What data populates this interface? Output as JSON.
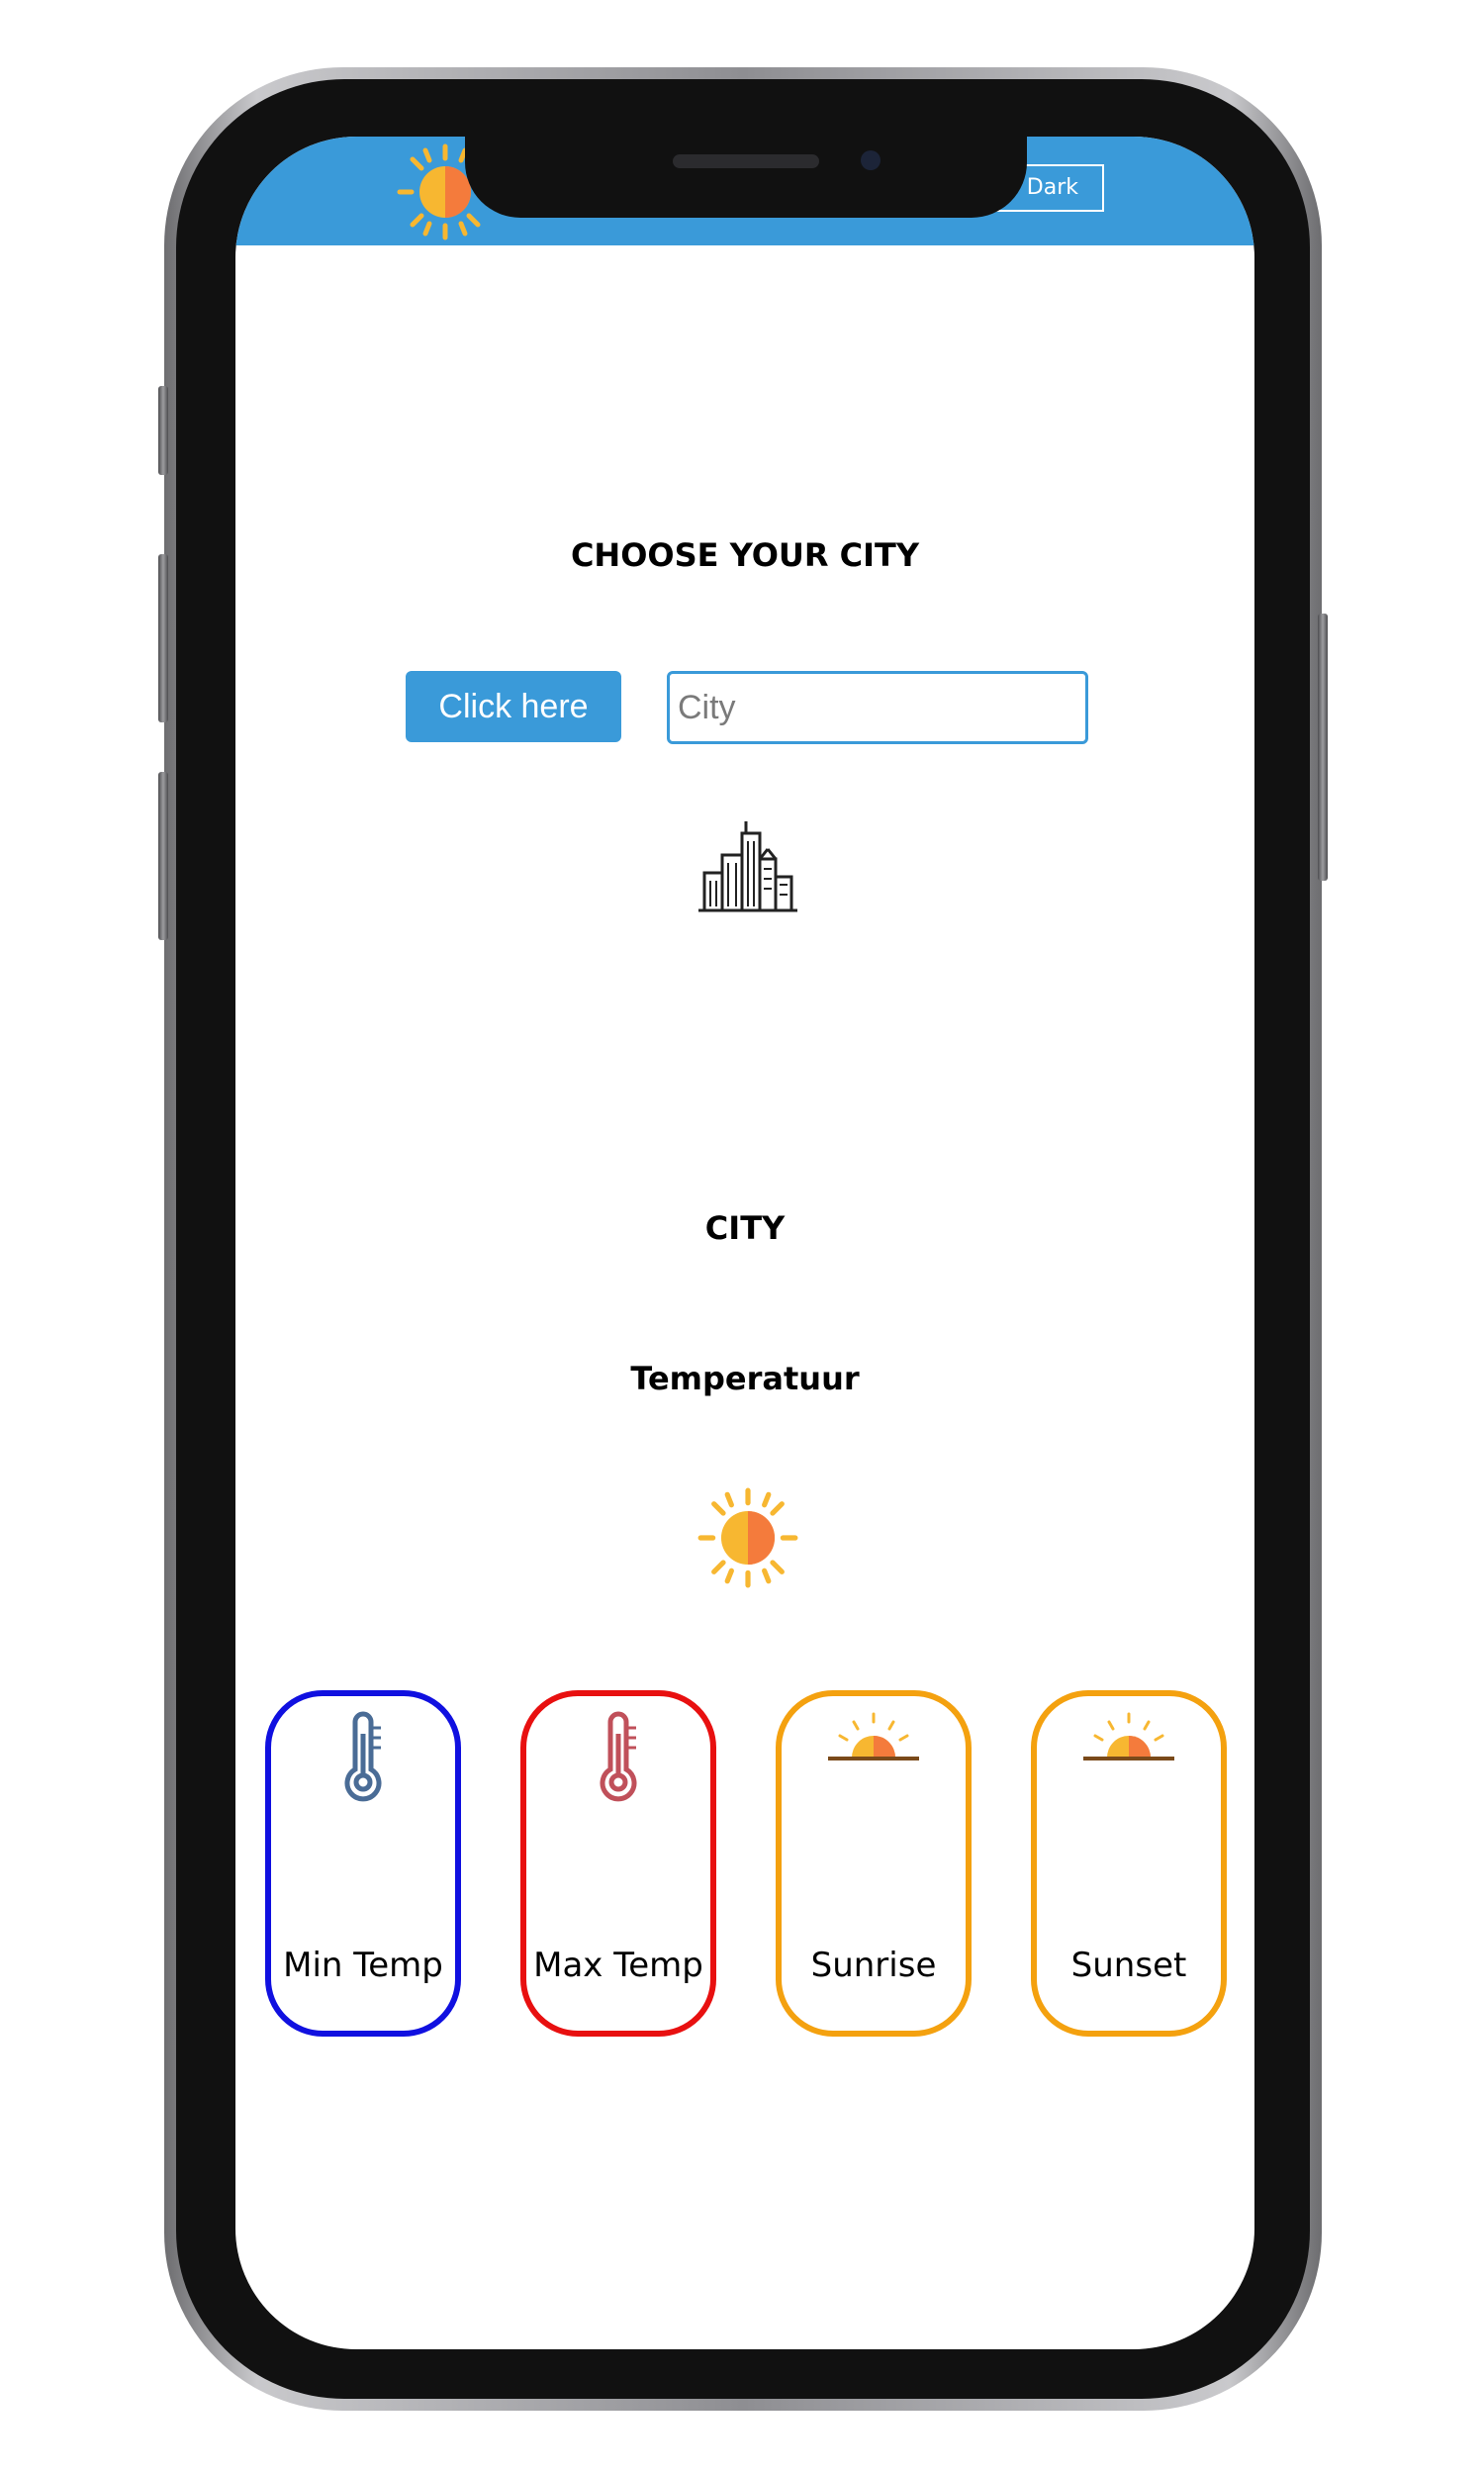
{
  "navbar": {
    "logo_icon": "sun-icon",
    "dark_toggle_label": "Dark",
    "background": "#3a9ad9"
  },
  "search": {
    "heading": "CHOOSE YOUR CITY",
    "button_label": "Click here",
    "input_value": "",
    "input_placeholder": "City",
    "city_icon": "city-buildings-icon"
  },
  "result": {
    "city_label": "CITY",
    "temperature_label": "Temperatuur",
    "weather_icon": "sun-icon"
  },
  "cards": [
    {
      "label": "Min Temp",
      "icon": "thermometer-icon",
      "border_color": "#1010e0"
    },
    {
      "label": "Max Temp",
      "icon": "thermometer-icon",
      "border_color": "#e81010"
    },
    {
      "label": "Sunrise",
      "icon": "sunrise-icon",
      "border_color": "#f4a10f"
    },
    {
      "label": "Sunset",
      "icon": "sunset-icon",
      "border_color": "#f4a10f"
    }
  ]
}
